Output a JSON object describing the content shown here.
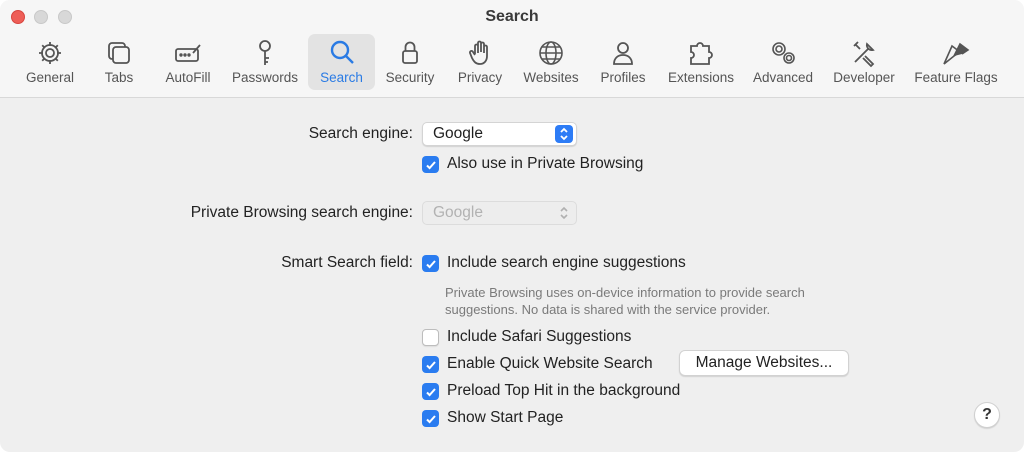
{
  "window": {
    "title": "Search"
  },
  "toolbar": {
    "items": [
      {
        "label": "General",
        "icon": "gear-icon"
      },
      {
        "label": "Tabs",
        "icon": "tabs-icon"
      },
      {
        "label": "AutoFill",
        "icon": "autofill-icon"
      },
      {
        "label": "Passwords",
        "icon": "key-icon"
      },
      {
        "label": "Search",
        "icon": "search-icon",
        "selected": true
      },
      {
        "label": "Security",
        "icon": "lock-icon"
      },
      {
        "label": "Privacy",
        "icon": "hand-icon"
      },
      {
        "label": "Websites",
        "icon": "globe-icon"
      },
      {
        "label": "Profiles",
        "icon": "person-icon"
      },
      {
        "label": "Extensions",
        "icon": "puzzle-icon"
      },
      {
        "label": "Advanced",
        "icon": "gears-icon"
      },
      {
        "label": "Developer",
        "icon": "tools-icon"
      },
      {
        "label": "Feature Flags",
        "icon": "flags-icon"
      }
    ]
  },
  "settings": {
    "search_engine_label": "Search engine:",
    "search_engine_value": "Google",
    "also_private": {
      "label": "Also use in Private Browsing",
      "checked": true
    },
    "private_engine_label": "Private Browsing search engine:",
    "private_engine_value": "Google",
    "smart_field_label": "Smart Search field:",
    "include_suggestions": {
      "label": "Include search engine suggestions",
      "checked": true
    },
    "note": "Private Browsing uses on-device information to provide search suggestions. No data is shared with the service provider.",
    "safari_suggestions": {
      "label": "Include Safari Suggestions",
      "checked": false
    },
    "quick_search": {
      "label": "Enable Quick Website Search",
      "checked": true
    },
    "manage_button": "Manage Websites...",
    "preload": {
      "label": "Preload Top Hit in the background",
      "checked": true
    },
    "start_page": {
      "label": "Show Start Page",
      "checked": true
    },
    "help": "?"
  },
  "colors": {
    "accent": "#2a7cf0",
    "close": "#ee5e57"
  }
}
